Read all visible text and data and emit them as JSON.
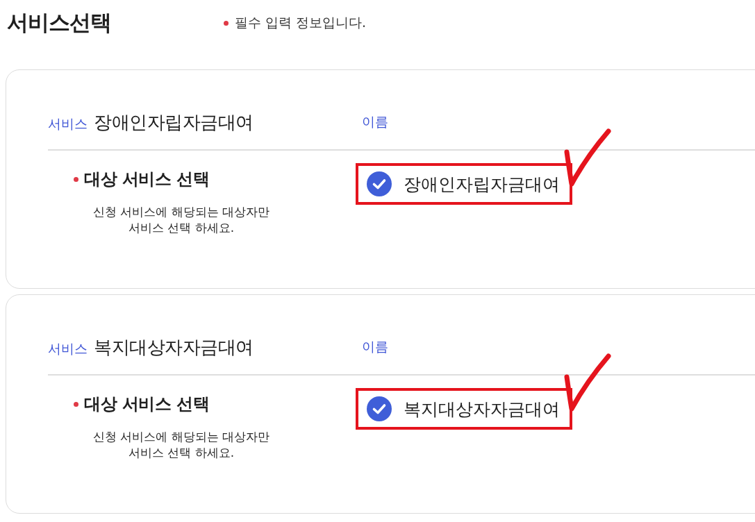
{
  "page": {
    "title": "서비스선택",
    "required_note": {
      "text": "필수 입력 정보입니다.",
      "required": true
    }
  },
  "cards": [
    {
      "service_label": "서비스",
      "service_name": "장애인자립자금대여",
      "name_label": "이름",
      "field_label": "대상 서비스 선택",
      "field_required": true,
      "field_hint": "신청 서비스에 해당되는 대상자만\n서비스 선택 하세요.",
      "option": {
        "label": "장애인자립자금대여",
        "checked": true,
        "highlighted": true
      }
    },
    {
      "service_label": "서비스",
      "service_name": "복지대상자자금대여",
      "name_label": "이름",
      "field_label": "대상 서비스 선택",
      "field_required": true,
      "field_hint": "신청 서비스에 해당되는 대상자만\n서비스 선택 하세요.",
      "option": {
        "label": "복지대상자자금대여",
        "checked": true,
        "highlighted": true
      }
    }
  ]
}
